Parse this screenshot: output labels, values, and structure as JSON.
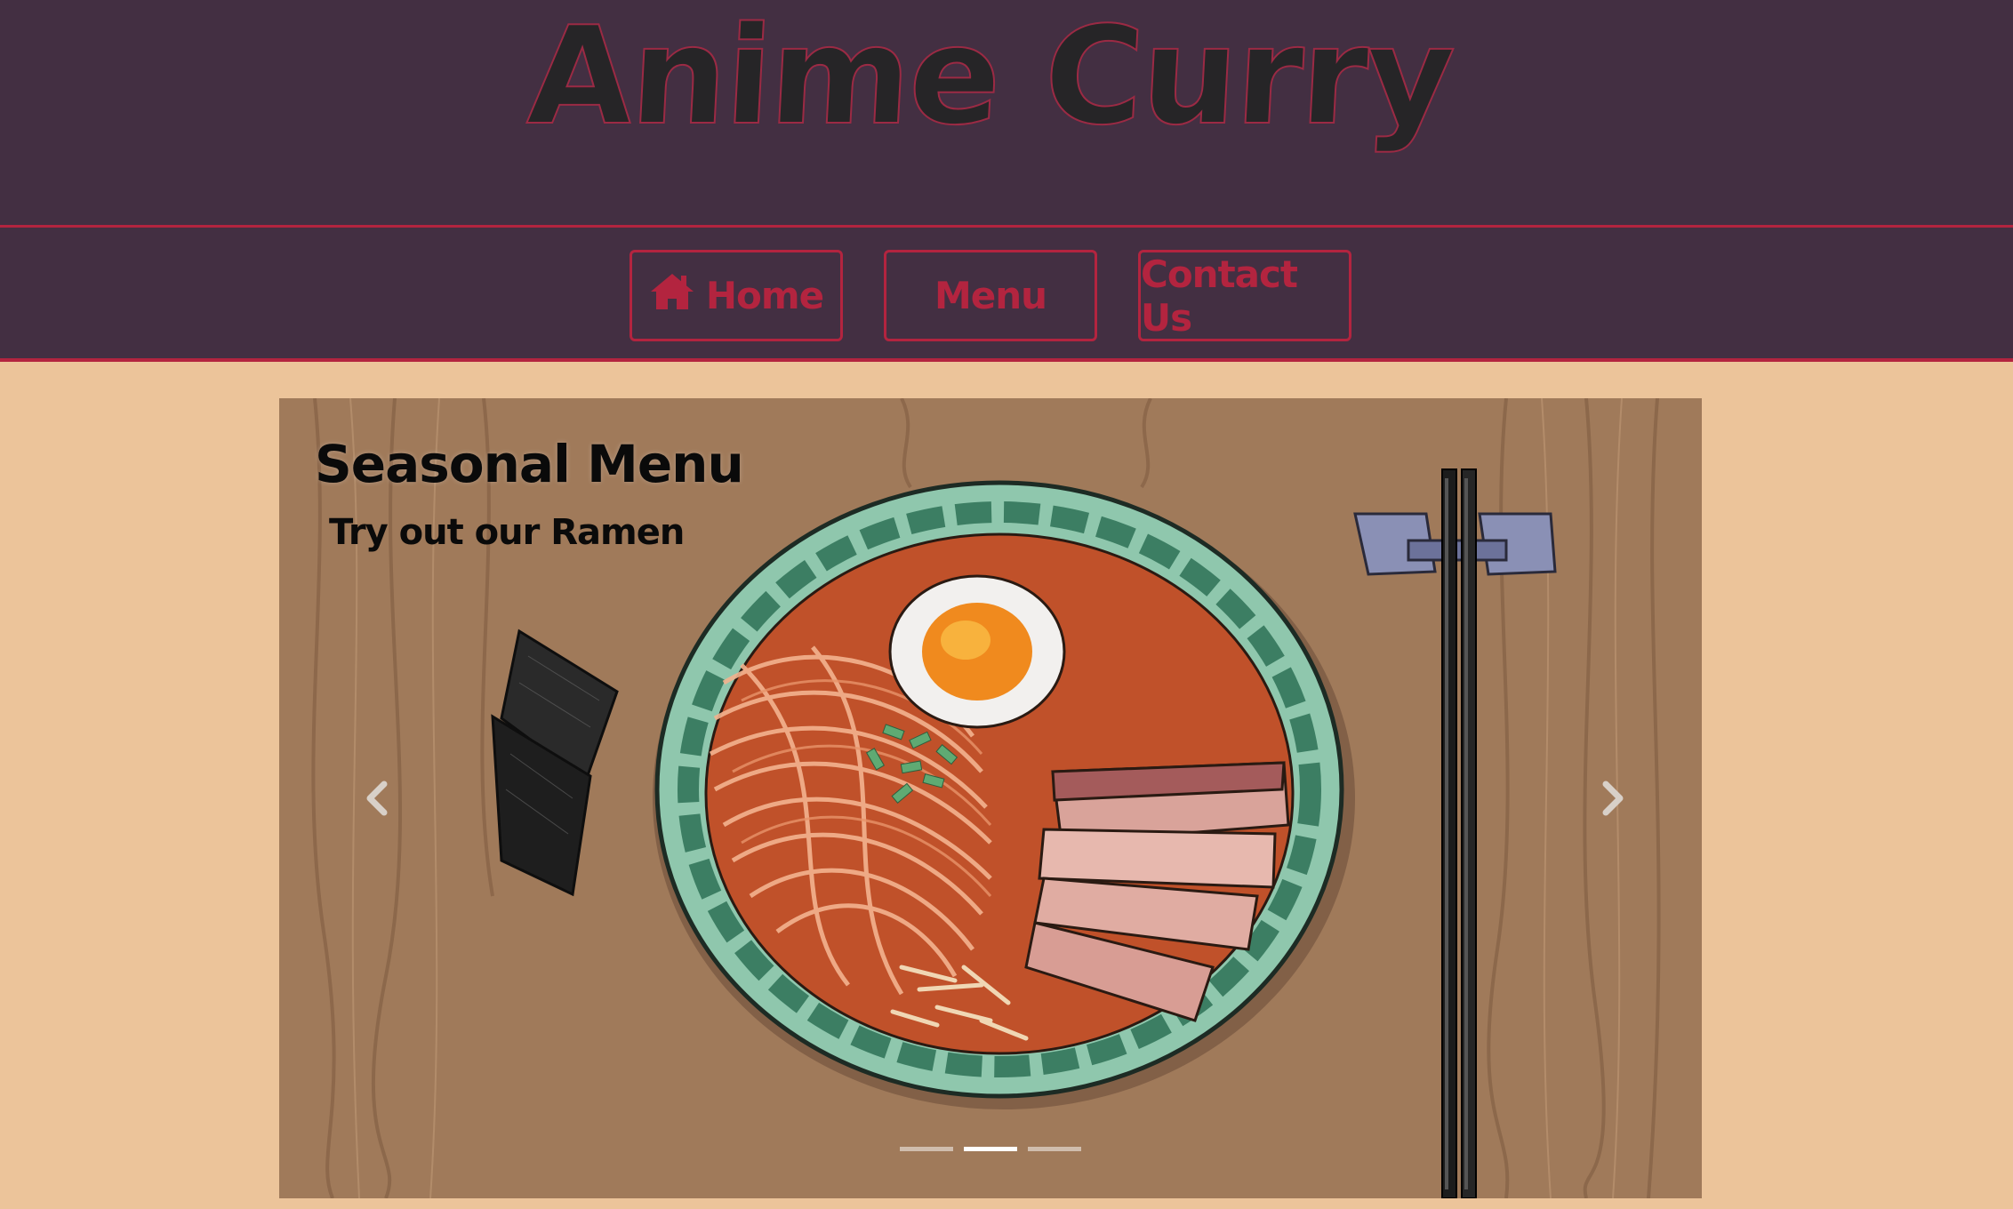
{
  "header": {
    "title": "Anime Curry"
  },
  "nav": {
    "items": [
      {
        "label": "Home",
        "icon": "home-icon"
      },
      {
        "label": "Menu"
      },
      {
        "label": "Contact Us"
      }
    ]
  },
  "carousel": {
    "caption_title": "Seasonal Menu",
    "caption_subtitle": "Try out our Ramen",
    "slide_count": 3,
    "active_slide": 2,
    "prev_icon": "chevron-left-icon",
    "next_icon": "chevron-right-icon"
  },
  "colors": {
    "header_bg": "#432f42",
    "accent": "#b3243f",
    "page_bg": "#ecc49a",
    "title_fill": "#262527"
  }
}
